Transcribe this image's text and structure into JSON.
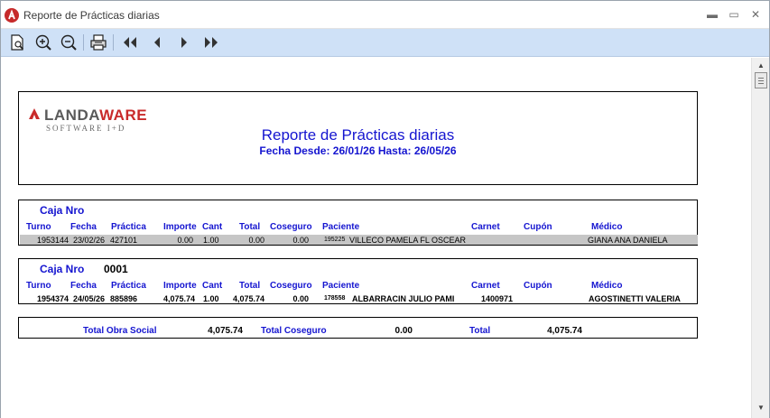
{
  "window": {
    "title": "Reporte de Prácticas diarias",
    "controls": {
      "minimize": "▬",
      "restore": "▭",
      "close": "✕"
    }
  },
  "toolbar": {
    "buttons": [
      {
        "name": "page-setup-icon"
      },
      {
        "name": "zoom-in-icon"
      },
      {
        "name": "zoom-out-icon"
      },
      {
        "name": "print-icon"
      },
      {
        "name": "first-page-icon"
      },
      {
        "name": "previous-page-icon"
      },
      {
        "name": "next-page-icon"
      },
      {
        "name": "last-page-icon"
      }
    ]
  },
  "report": {
    "logo": {
      "part1": "LANDA",
      "part2": "WARE",
      "sub": "SOFTWARE I+D",
      "accent": "#c92a2a"
    },
    "title": "Reporte de Prácticas diarias",
    "subtitle": "Fecha Desde: 26/01/26 Hasta: 26/05/26",
    "accent_color": "#1515d0",
    "columns": {
      "turno": "Turno",
      "fecha": "Fecha",
      "practica": "Práctica",
      "importe": "Importe",
      "cant": "Cant",
      "total": "Total",
      "coseguro": "Coseguro",
      "paciente": "Paciente",
      "carnet": "Carnet",
      "cupon": "Cupón",
      "medico": "Médico"
    },
    "cajas": [
      {
        "label": "Caja Nro",
        "number": "",
        "rows": [
          {
            "turno": "1953144",
            "fecha": "23/02/26",
            "practica": "427101",
            "importe": "0.00",
            "cant": "1.00",
            "total": "0.00",
            "coseguro": "0.00",
            "paciente_id": "195225",
            "paciente": "VILLECO PAMELA FL  OSCEAR",
            "carnet": "",
            "cupon": "",
            "medico": "GIANA ANA DANIELA",
            "highlighted": true
          }
        ]
      },
      {
        "label": "Caja Nro",
        "number": "0001",
        "rows": [
          {
            "turno": "1954374",
            "fecha": "24/05/26",
            "practica": "885896",
            "importe": "4,075.74",
            "cant": "1.00",
            "total": "4,075.74",
            "coseguro": "0.00",
            "paciente_id": "178558",
            "paciente": "ALBARRACIN JULIO  PAMI",
            "carnet": "1400971",
            "cupon": "",
            "medico": "AGOSTINETTI VALERIA",
            "highlighted": false
          }
        ]
      }
    ],
    "totals": {
      "obra_social_label": "Total Obra Social",
      "obra_social_value": "4,075.74",
      "coseguro_label": "Total Coseguro",
      "coseguro_value": "0.00",
      "total_label": "Total",
      "total_value": "4,075.74"
    }
  }
}
